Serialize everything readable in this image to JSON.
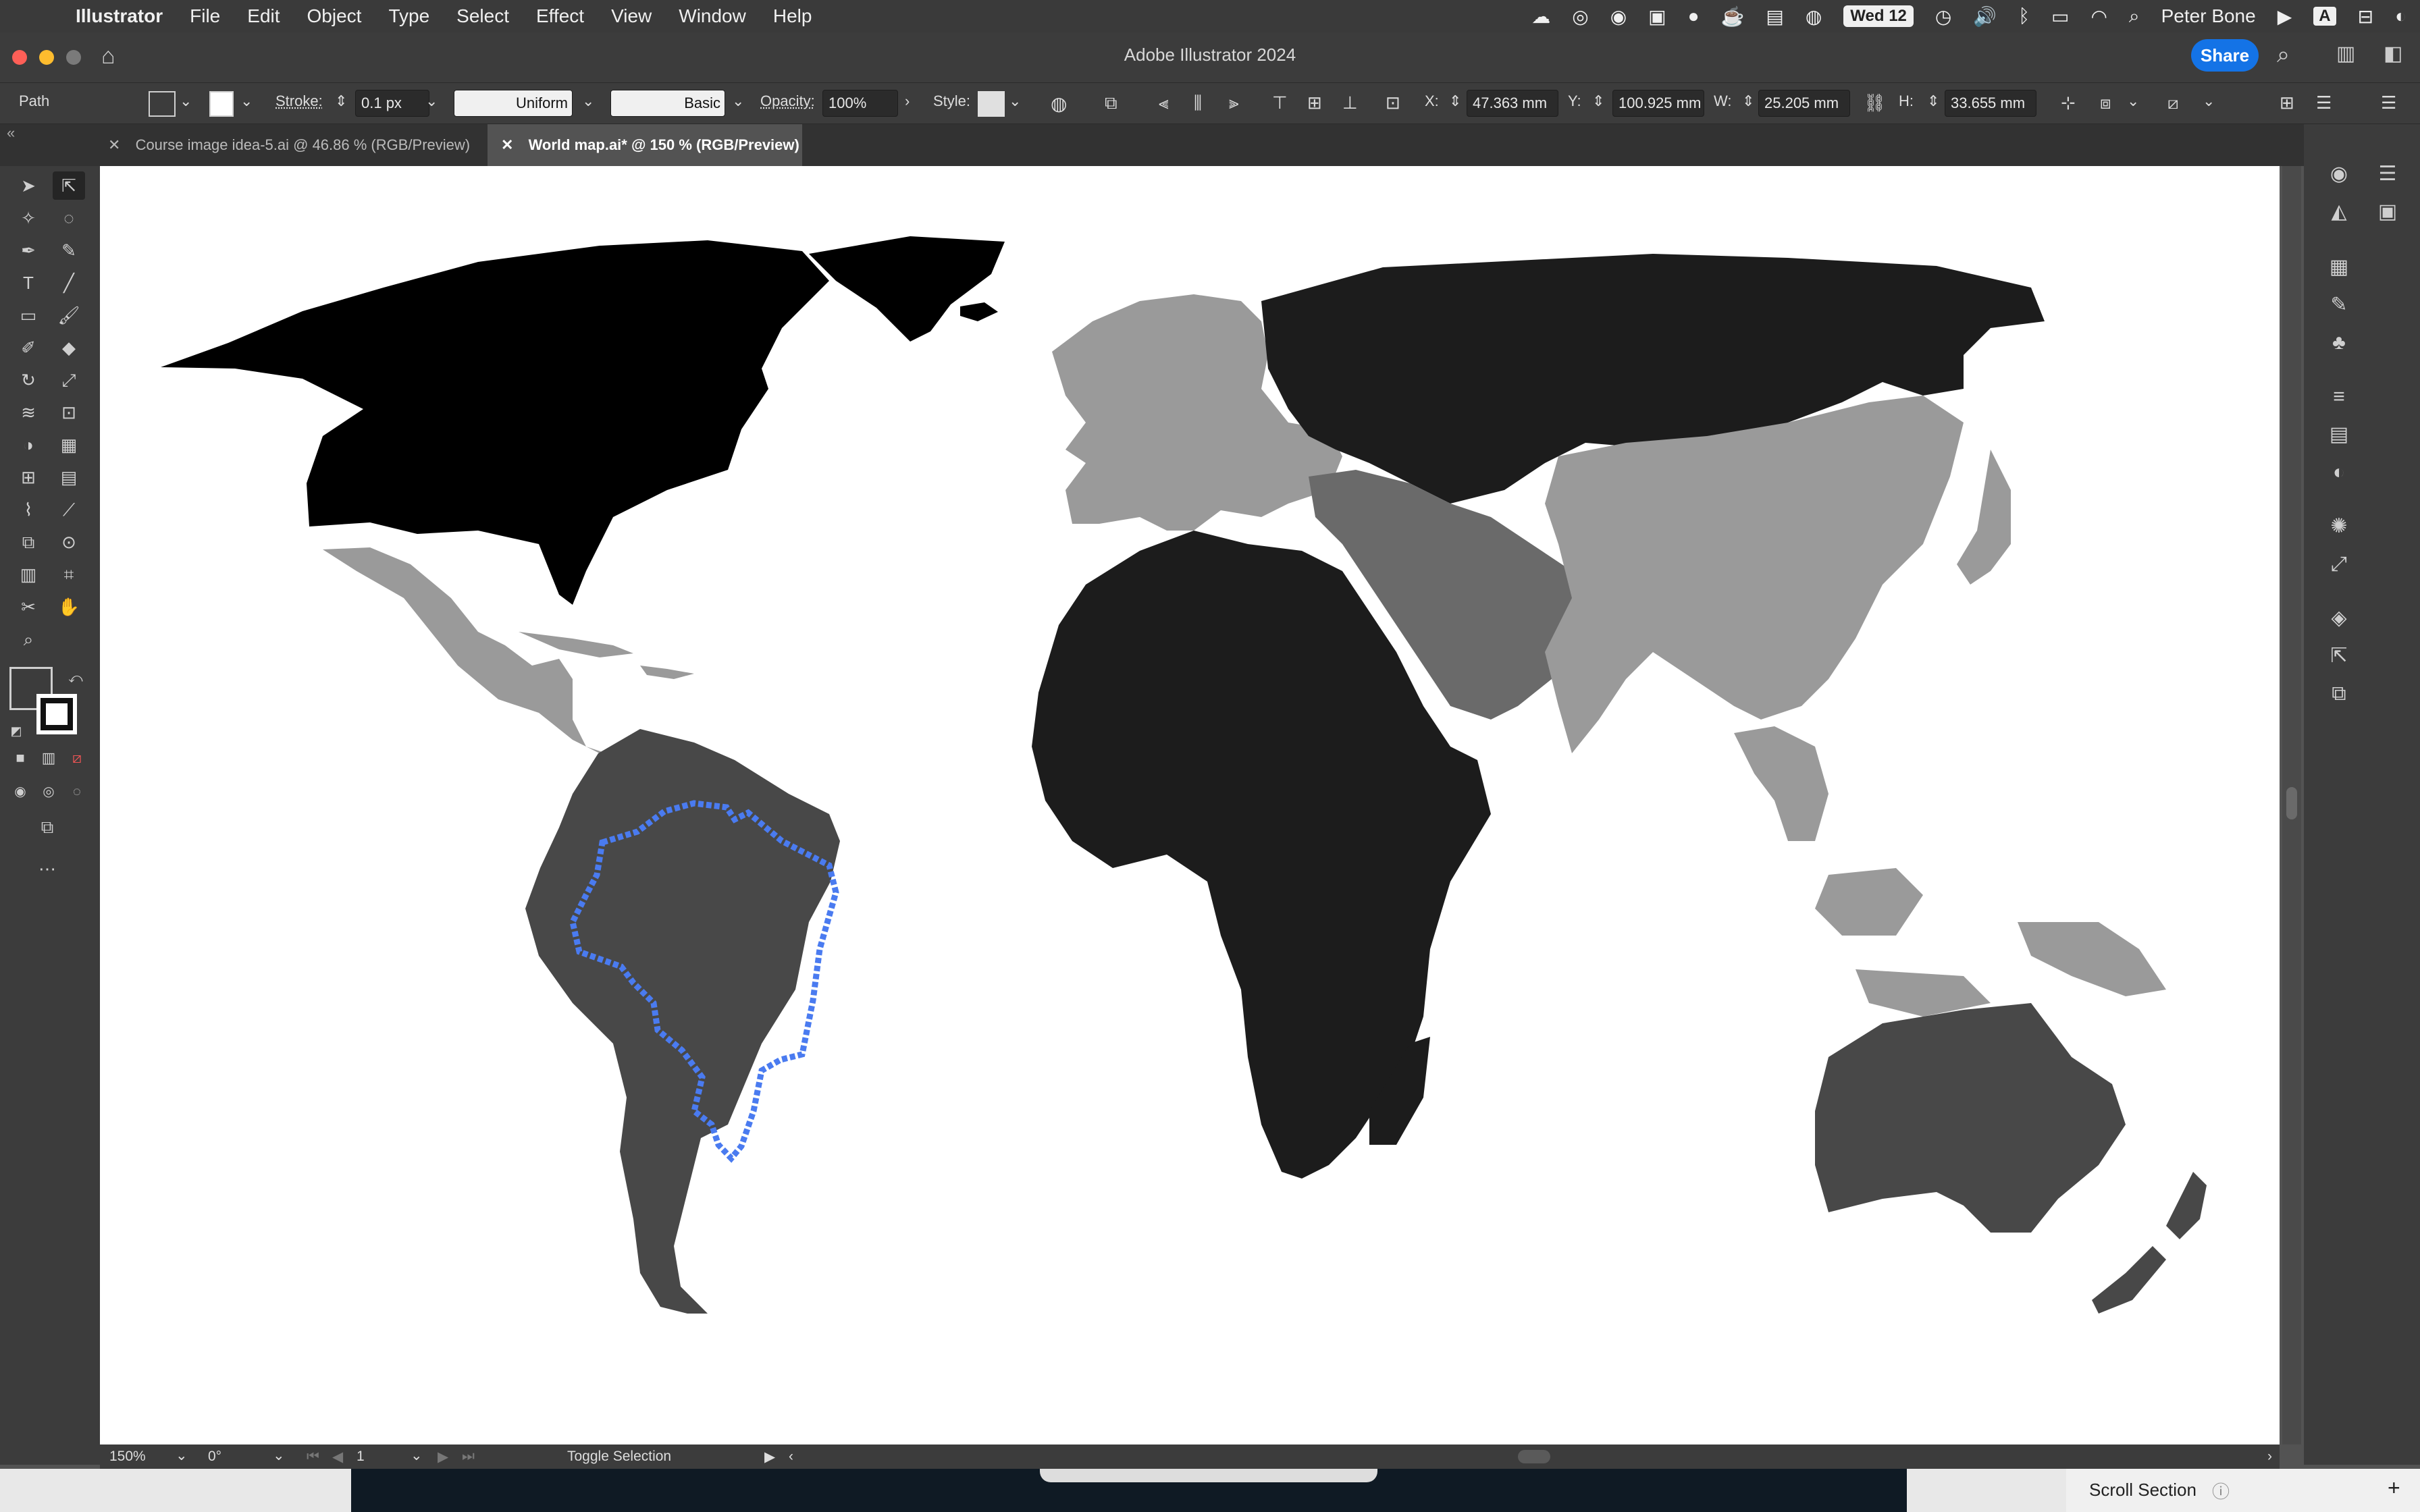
{
  "mac_menu": {
    "app": "Illustrator",
    "items": [
      "File",
      "Edit",
      "Object",
      "Type",
      "Select",
      "Effect",
      "View",
      "Window",
      "Help"
    ],
    "date": "Wed 12",
    "user": "Peter Bone"
  },
  "window": {
    "title": "Adobe Illustrator 2024",
    "share": "Share"
  },
  "control_bar": {
    "selection_type": "Path",
    "stroke_label": "Stroke:",
    "stroke_value": "0.1 px",
    "profile": "Uniform",
    "brush": "Basic",
    "opacity_label": "Opacity:",
    "opacity_value": "100%",
    "style_label": "Style:",
    "x_label": "X:",
    "x_value": "47.363 mm",
    "y_label": "Y:",
    "y_value": "100.925 mm",
    "w_label": "W:",
    "w_value": "25.205 mm",
    "h_label": "H:",
    "h_value": "33.655 mm"
  },
  "tabs": [
    {
      "label": "Course image idea-5.ai @ 46.86 % (RGB/Preview)"
    },
    {
      "label": "World map.ai* @ 150 % (RGB/Preview)"
    }
  ],
  "status": {
    "zoom": "150%",
    "rotation": "0°",
    "artboard": "1",
    "tool": "Toggle Selection"
  },
  "bottom": {
    "scroll_section": "Scroll Section"
  },
  "colors": {
    "north_america": "#000000",
    "russia_africa": "#1c1c1c",
    "south_america_oceania": "#484848",
    "middle_east": "#6a6a6a",
    "asia_europe": "#9a9a9a",
    "selection": "#4a7bf0"
  }
}
